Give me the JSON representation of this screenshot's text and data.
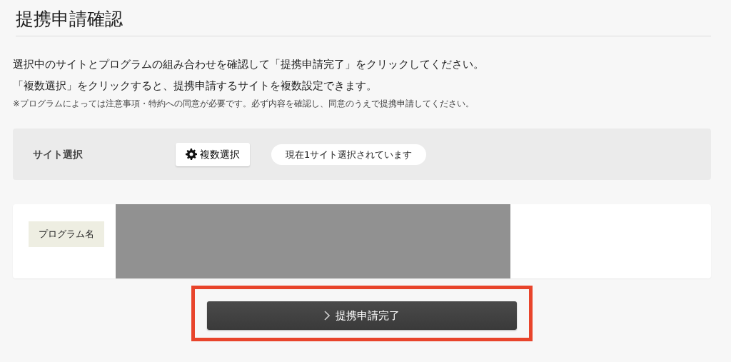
{
  "page": {
    "title": "提携申請確認"
  },
  "intro": [
    "選択中のサイトとプログラムの組み合わせを確認して「提携申請完了」をクリックしてください。",
    "「複数選択」をクリックすると、提携申請するサイトを複数設定できます。"
  ],
  "note": "※プログラムによっては注意事項・特約への同意が必要です。必ず内容を確認し、同意のうえで提携申請してください。",
  "site_select": {
    "label": "サイト選択",
    "button": "複数選択",
    "status": "現在1サイト選択されています"
  },
  "program": {
    "label": "プログラム名",
    "redacted": true
  },
  "submit": {
    "label": "提携申請完了",
    "highlighted": true
  }
}
